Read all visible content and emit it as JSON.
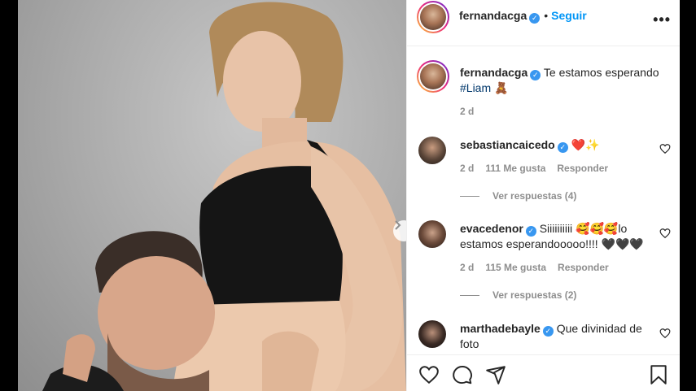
{
  "post": {
    "author": "fernandacga",
    "follow_label": "Seguir",
    "more_label": "•••",
    "caption_text": "Te estamos esperando",
    "caption_hashtag": "#Liam",
    "caption_emoji": "🧸",
    "caption_time": "2 d"
  },
  "comments": [
    {
      "username": "sebastiancaicedo",
      "text": "❤️✨",
      "time": "2 d",
      "likes": "111 Me gusta",
      "reply_label": "Responder",
      "view_replies": "Ver respuestas (4)"
    },
    {
      "username": "evacedenor",
      "text": "Siiiiiiiiii 🥰🥰🥰lo estamos esperandooooo!!!! 🖤🖤🖤",
      "time": "2 d",
      "likes": "115 Me gusta",
      "reply_label": "Responder",
      "view_replies": "Ver respuestas (2)"
    },
    {
      "username": "marthadebayle",
      "text": "Que divinidad de foto"
    }
  ],
  "icons": {
    "verified": "✓",
    "next": "›"
  },
  "colors": {
    "link_blue": "#0095f6",
    "verified_blue": "#3897f0",
    "secondary_text": "#8e8e8e"
  }
}
